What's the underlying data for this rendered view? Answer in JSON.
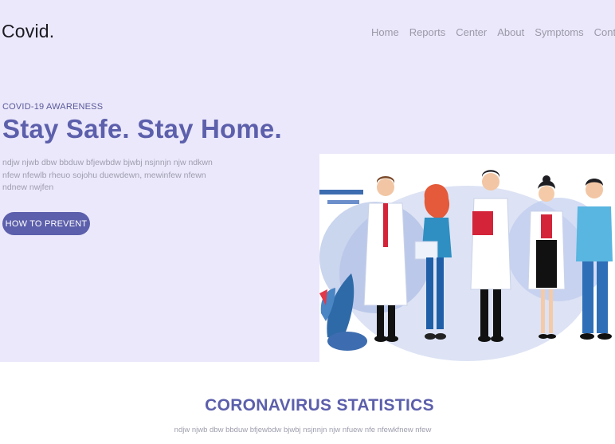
{
  "brand": {
    "logo": "Covid."
  },
  "nav": {
    "items": [
      "Home",
      "Reports",
      "Center",
      "About",
      "Symptoms",
      "Contact"
    ]
  },
  "hero": {
    "kicker": "COVID-19 AWARENESS",
    "headline": "Stay Safe. Stay Home.",
    "blurb": "ndjw njwb dbw bbduw bfjewbdw bjwbj nsjnnjn njw ndkwn nfew nfewlb rheuo sojohu duewdewn, mewinfew nfewn ndnew nwjfen",
    "cta_label": "HOW TO PREVENT"
  },
  "stats": {
    "title": "CORONAVIRUS STATISTICS",
    "subtitle": "ndjw njwb dbw bbduw bfjewbdw bjwbj nsjnnjn njw nfuew nfe nfewkfnew nfew"
  },
  "colors": {
    "accent": "#5c5fab",
    "hero_bg": "#ebe8fb"
  }
}
